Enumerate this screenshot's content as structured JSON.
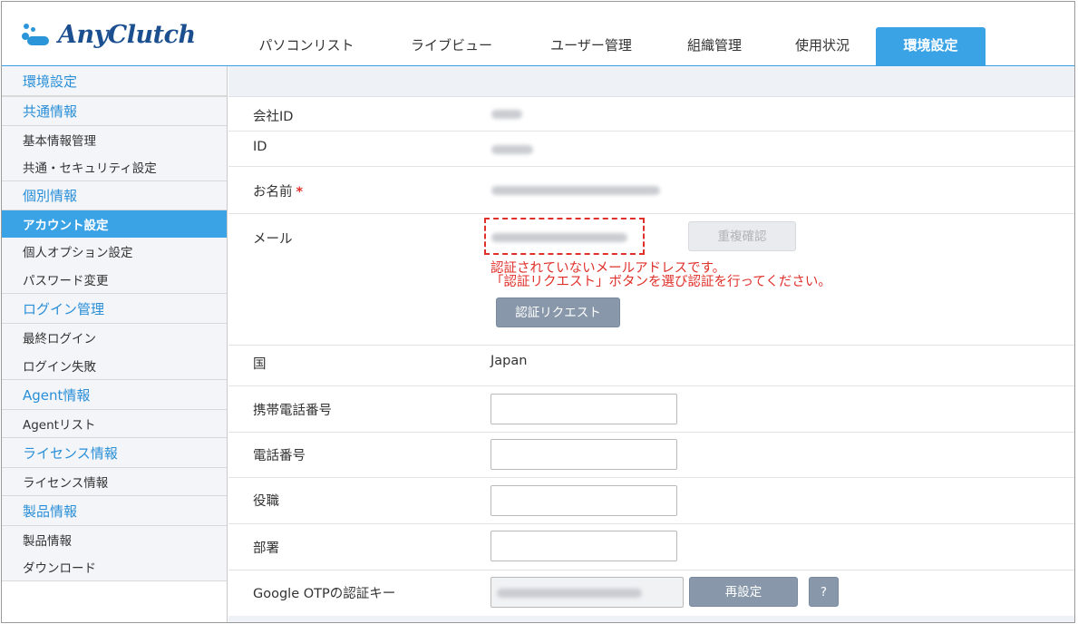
{
  "brand": {
    "name": "AnyClutch"
  },
  "nav": {
    "tabs": [
      {
        "label": "パソコンリスト"
      },
      {
        "label": "ライブビュー"
      },
      {
        "label": "ユーザー管理"
      },
      {
        "label": "組織管理"
      },
      {
        "label": "使用状況"
      },
      {
        "label": "環境設定",
        "active": true
      }
    ]
  },
  "sidebar": {
    "items": [
      {
        "label": "環境設定",
        "type": "head"
      },
      {
        "label": "共通情報",
        "type": "head"
      },
      {
        "label": "基本情報管理",
        "type": "item"
      },
      {
        "label": "共通・セキュリティ設定",
        "type": "item"
      },
      {
        "label": "個別情報",
        "type": "head"
      },
      {
        "label": "アカウント設定",
        "type": "item",
        "active": true
      },
      {
        "label": "個人オプション設定",
        "type": "item"
      },
      {
        "label": "パスワード変更",
        "type": "item"
      },
      {
        "label": "ログイン管理",
        "type": "head"
      },
      {
        "label": "最終ログイン",
        "type": "item"
      },
      {
        "label": "ログイン失敗",
        "type": "item"
      },
      {
        "label": "Agent情報",
        "type": "head"
      },
      {
        "label": "Agentリスト",
        "type": "item"
      },
      {
        "label": "ライセンス情報",
        "type": "head"
      },
      {
        "label": "ライセンス情報",
        "type": "item"
      },
      {
        "label": "製品情報",
        "type": "head"
      },
      {
        "label": "製品情報",
        "type": "item"
      },
      {
        "label": "ダウンロード",
        "type": "item"
      }
    ]
  },
  "form": {
    "company_id": {
      "label": "会社ID"
    },
    "id": {
      "label": "ID"
    },
    "name": {
      "label": "お名前",
      "required_mark": "*"
    },
    "mail": {
      "label": "メール",
      "dup_check_label": "重複確認",
      "warning_line1": "認証されていないメールアドレスです。",
      "warning_line2": "「認証リクエスト」ボタンを選び認証を行ってください。",
      "verify_button": "認証リクエスト"
    },
    "country": {
      "label": "国",
      "value": "Japan"
    },
    "mobile": {
      "label": "携帯電話番号",
      "value": ""
    },
    "phone": {
      "label": "電話番号",
      "value": ""
    },
    "title": {
      "label": "役職",
      "value": ""
    },
    "department": {
      "label": "部署",
      "value": ""
    },
    "otp": {
      "label": "Google OTPの認証キー",
      "reset_button": "再設定",
      "help_button": "?"
    }
  }
}
